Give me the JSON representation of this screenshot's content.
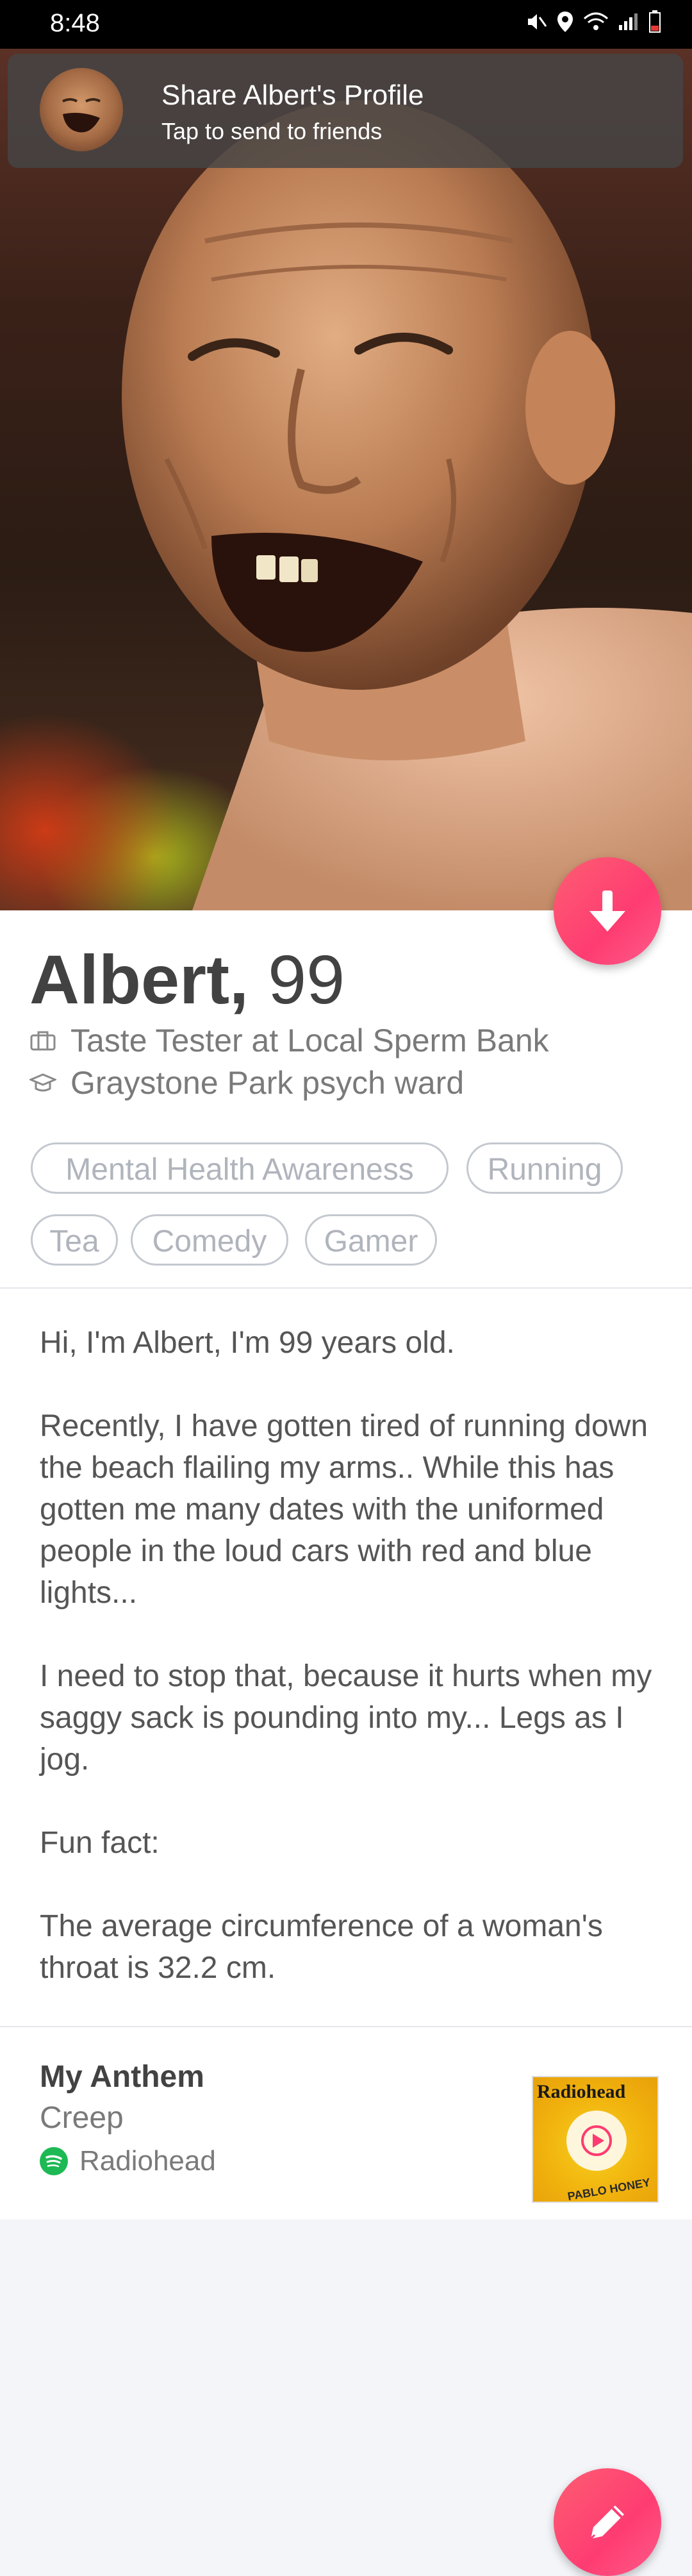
{
  "status_bar": {
    "time": "8:48"
  },
  "share_banner": {
    "title": "Share Albert's Profile",
    "subtitle": "Tap to send to friends"
  },
  "profile": {
    "name": "Albert,",
    "age": "99",
    "job": "Taste Tester at Local Sperm Bank",
    "school": "Graystone Park psych ward",
    "interests": [
      "Mental Health Awareness",
      "Running",
      "Tea",
      "Comedy",
      "Gamer"
    ]
  },
  "bio": {
    "text": "Hi, I'm Albert, I'm 99 years old.\n\nRecently, I have gotten tired of running down the beach flailing my arms.. While this has gotten me many dates with the uniformed people in the loud cars with red and blue lights...\n\nI need to stop that, because it hurts when my saggy sack is pounding into my... Legs as I jog.\n\nFun fact:\n\nThe average circumference of a woman's throat is 32.2 cm."
  },
  "anthem": {
    "heading": "My Anthem",
    "song": "Creep",
    "artist": "Radiohead",
    "album_label": "Radiohead",
    "album_sub": "PABLO HONEY"
  },
  "colors": {
    "accent": "#fe3c72",
    "spotify": "#1db954"
  },
  "icons": {
    "down": "arrow-down-icon",
    "edit": "pencil-icon",
    "job": "briefcase-icon",
    "school": "graduation-cap-icon"
  }
}
